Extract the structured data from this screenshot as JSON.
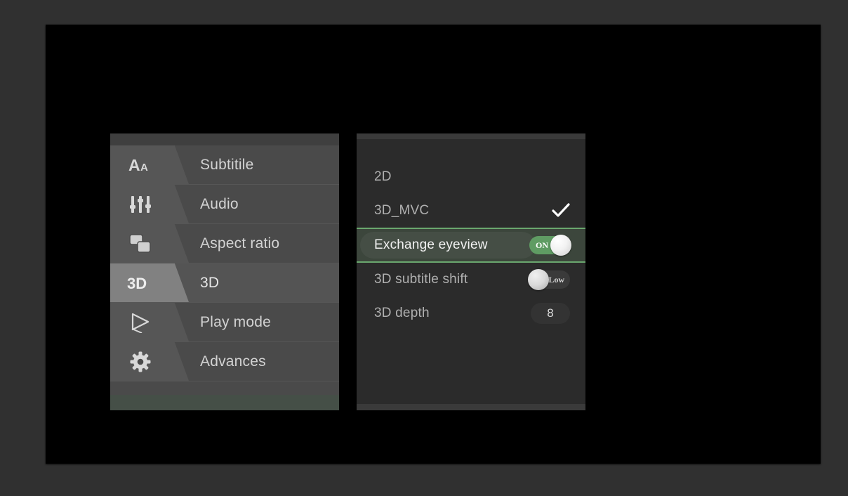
{
  "theme": {
    "outer_background": "#303030",
    "video_background": "#000000",
    "sidebar_background": "#4a4a4a",
    "sidebar_selected_background": "#545454",
    "options_background": "#2b2b2b",
    "accent_green": "#6aa76e",
    "toggle_on_green": "#5f9c63",
    "text_primary": "#d3d3d3",
    "text_secondary": "#b0b0b0"
  },
  "sidebar": {
    "items": [
      {
        "label": "Subtitile",
        "icon": "subtitle-font-icon",
        "selected": false
      },
      {
        "label": "Audio",
        "icon": "audio-faders-icon",
        "selected": false
      },
      {
        "label": "Aspect ratio",
        "icon": "aspect-ratio-icon",
        "selected": false
      },
      {
        "label": "3D",
        "icon": "three-d-icon",
        "selected": true
      },
      {
        "label": "Play mode",
        "icon": "play-mode-icon",
        "selected": false
      },
      {
        "label": "Advances",
        "icon": "gear-icon",
        "selected": false
      }
    ]
  },
  "options": {
    "items": [
      {
        "label": "2D",
        "control": "none",
        "highlighted": false,
        "checked": false
      },
      {
        "label": "3D_MVC",
        "control": "check",
        "highlighted": false,
        "checked": true,
        "check_icon": "checkmark-icon"
      },
      {
        "label": "Exchange eyeview",
        "control": "toggle",
        "highlighted": true,
        "toggle_state": "on",
        "toggle_text": "ON"
      },
      {
        "label": "3D subtitle shift",
        "control": "toggle",
        "highlighted": false,
        "toggle_state": "off",
        "toggle_text": "Low"
      },
      {
        "label": "3D depth",
        "control": "value",
        "highlighted": false,
        "value": "8"
      }
    ]
  }
}
